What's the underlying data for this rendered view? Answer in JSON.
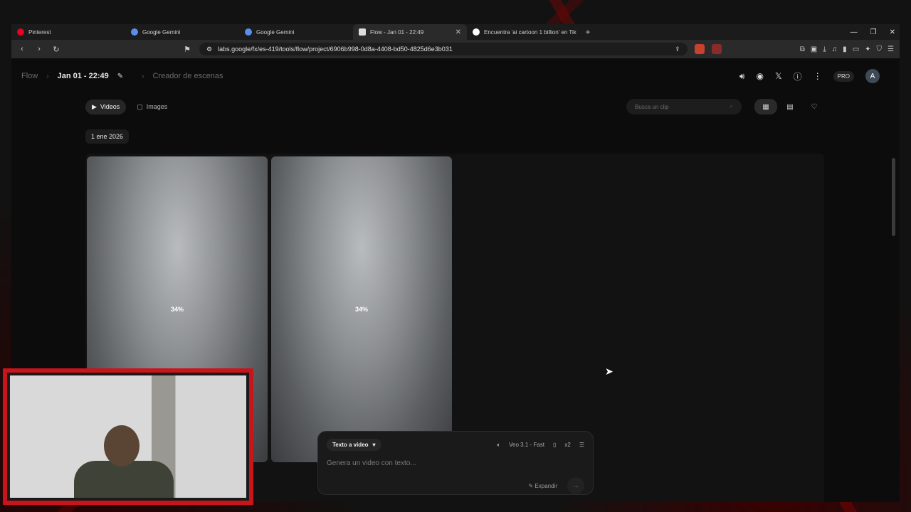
{
  "browser": {
    "tabs": [
      {
        "label": "Pinterest",
        "favicon_color": "#e60023",
        "active": false
      },
      {
        "label": "Google Gemini",
        "favicon_color": "#5b8def",
        "active": false
      },
      {
        "label": "Google Gemini",
        "favicon_color": "#5b8def",
        "active": false
      },
      {
        "label": "Flow - Jan 01 - 22:49",
        "favicon_color": "#dddddd",
        "active": true
      },
      {
        "label": "Encuentra 'ai cartoon 1 billion' en Tik",
        "favicon_color": "#ffffff",
        "active": false
      }
    ],
    "url": "labs.google/fx/es-419/tools/flow/project/6906b998-0d8a-4408-bd50-4825d6e3b031"
  },
  "app": {
    "breadcrumb": {
      "root": "Flow",
      "project": "Jan 01 - 22:49",
      "section": "Creador de escenas"
    },
    "header": {
      "pro_label": "PRO",
      "avatar_letter": "A"
    },
    "filters": {
      "videos_label": "Videos",
      "images_label": "Images",
      "search_placeholder": "Busca un clip"
    },
    "date_group": "1 ene 2026",
    "cards": [
      {
        "progress_label": "34%",
        "progress": 0.34
      },
      {
        "progress_label": "34%",
        "progress": 0.34
      }
    ],
    "composer": {
      "mode_label": "Texto a video",
      "model_label": "Veo 3.1 - Fast",
      "count_label": "x2",
      "prompt_placeholder": "Genera un video con texto...",
      "expand_label": "Expandir"
    }
  },
  "colors": {
    "accent_red": "#c8141b",
    "page_bg": "#0c0c0c"
  }
}
